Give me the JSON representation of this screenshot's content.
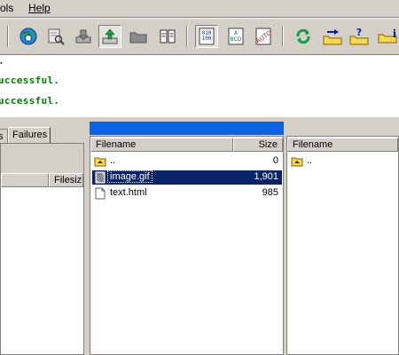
{
  "menu": {
    "tools_label": "ols",
    "help_label": "Help"
  },
  "toolbar": {
    "buttons": [
      {
        "icon": "globe-connect-icon"
      },
      {
        "icon": "document-search-icon"
      },
      {
        "icon": "download-icon"
      },
      {
        "icon": "upload-icon"
      },
      {
        "icon": "folder-icon"
      },
      {
        "icon": "book-icon"
      },
      {
        "icon": "binary-mode-icon"
      },
      {
        "icon": "ascii-mode-icon"
      },
      {
        "icon": "auto-mode-icon"
      },
      {
        "icon": "refresh-icon"
      },
      {
        "icon": "folder-transfer-icon"
      },
      {
        "icon": "folder-help-icon"
      },
      {
        "icon": "folder-info-icon"
      }
    ]
  },
  "log": {
    "lines": [
      ".",
      "uccessful.",
      "uccessful."
    ]
  },
  "left": {
    "tab_partial": "s",
    "tab_failures": "Failures",
    "col_filesize": "Filesiz"
  },
  "middle": {
    "col_filename": "Filename",
    "col_size": "Size",
    "files": [
      {
        "name": "..",
        "size": "0",
        "icon": "parent-folder-icon",
        "selected": false
      },
      {
        "name": "image.gif",
        "size": "1,901",
        "icon": "image-file-icon",
        "selected": true
      },
      {
        "name": "text.html",
        "size": "985",
        "icon": "html-file-icon",
        "selected": false
      }
    ]
  },
  "right": {
    "col_filename": "Filename",
    "files": [
      {
        "name": "..",
        "icon": "parent-folder-icon"
      }
    ]
  },
  "colors": {
    "selection": "#0a246a",
    "panel_title": "#0a64e6",
    "log_text": "#008000"
  }
}
